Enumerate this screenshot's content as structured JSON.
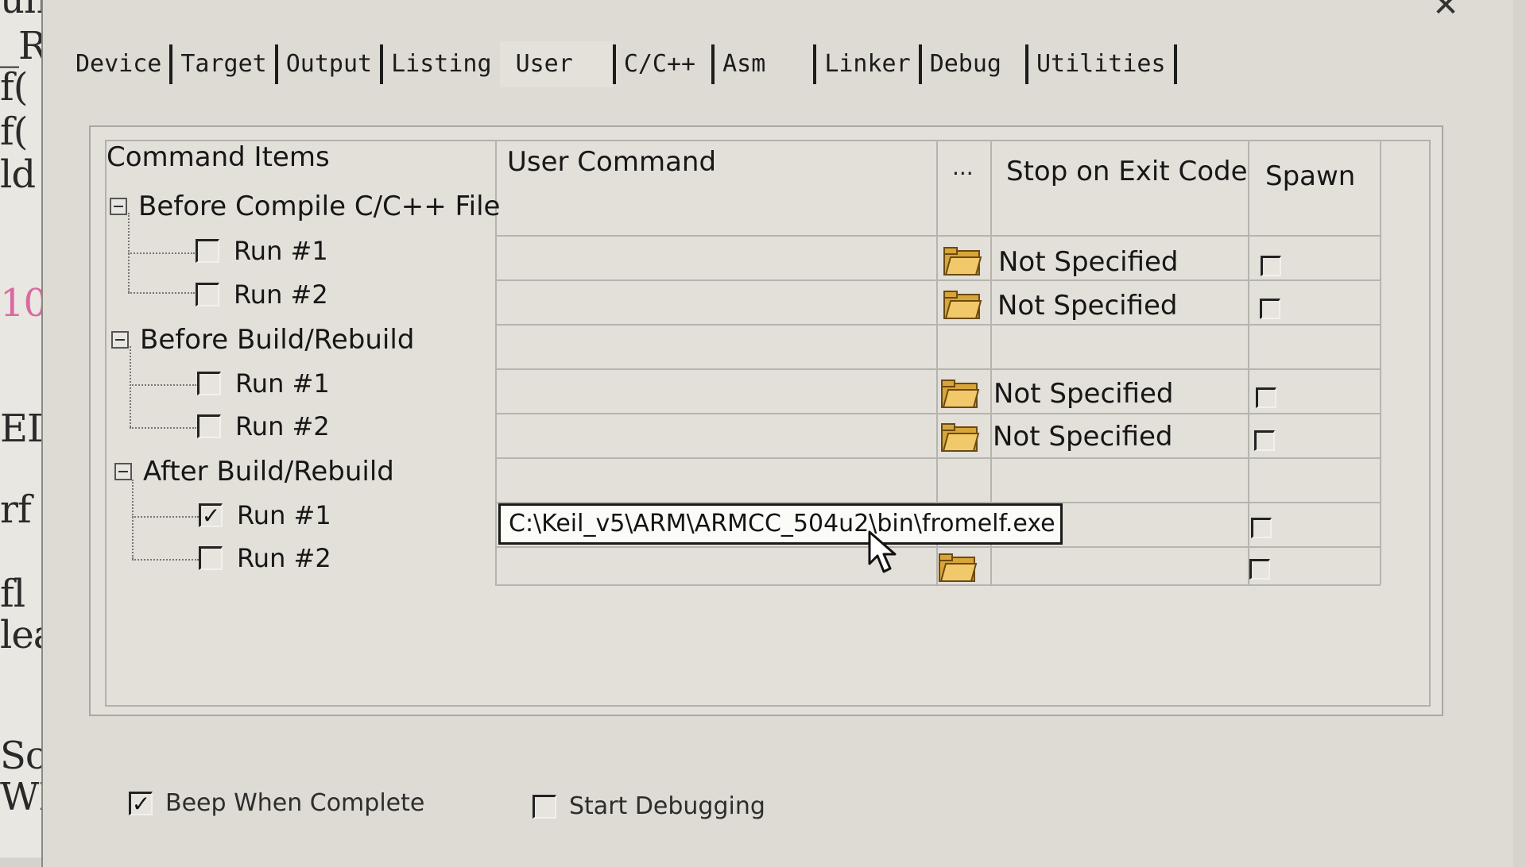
{
  "editor_lines": [
    {
      "text": "un",
      "red": false
    },
    {
      "text": "_R",
      "red": false
    },
    {
      "text": "f(",
      "red": false
    },
    {
      "text": "f(",
      "red": false
    },
    {
      "text": "ld",
      "red": false
    },
    {
      "text": "10",
      "red": true
    },
    {
      "text": "ED",
      "red": false
    },
    {
      "text": "rf",
      "red": false
    },
    {
      "text": "fl",
      "red": false
    },
    {
      "text": "lea",
      "red": false
    },
    {
      "text": "Sca",
      "red": false
    },
    {
      "text": "WKU",
      "red": false
    }
  ],
  "dialog": {
    "close_glyph": "✕",
    "tabs": [
      {
        "label": "Device",
        "active": false
      },
      {
        "label": "Target",
        "active": false
      },
      {
        "label": "Output",
        "active": false
      },
      {
        "label": "Listing",
        "active": false
      },
      {
        "label": "User",
        "active": true
      },
      {
        "label": "C/C++",
        "active": false
      },
      {
        "label": "Asm",
        "active": false
      },
      {
        "label": "Linker",
        "active": false
      },
      {
        "label": "Debug",
        "active": false
      },
      {
        "label": "Utilities",
        "active": false
      }
    ]
  },
  "grid": {
    "headers": {
      "command_items": "Command Items",
      "user_command": "User Command",
      "browse": "...",
      "stop_on_exit": "Stop on Exit Code",
      "spawn": "Spawn"
    },
    "groups": [
      {
        "label": "Before Compile C/C++ File"
      },
      {
        "label": "Before Build/Rebuild"
      },
      {
        "label": "After Build/Rebuild"
      }
    ],
    "runs": [
      {
        "label": "Run #1",
        "checked": false,
        "command": "",
        "stop_code": "Not Specified",
        "spawn": false
      },
      {
        "label": "Run #2",
        "checked": false,
        "command": "",
        "stop_code": "Not Specified",
        "spawn": false
      },
      {
        "label": "Run #1",
        "checked": false,
        "command": "",
        "stop_code": "Not Specified",
        "spawn": false
      },
      {
        "label": "Run #2",
        "checked": false,
        "command": "",
        "stop_code": "Not Specified",
        "spawn": false
      },
      {
        "label": "Run #1",
        "checked": true,
        "command": "C:\\Keil_v5\\ARM\\ARMCC_504u2\\bin\\fromelf.exe",
        "stop_code": "",
        "spawn": false
      },
      {
        "label": "Run #2",
        "checked": false,
        "command": "",
        "stop_code": "",
        "spawn": false
      }
    ]
  },
  "options": {
    "beep_label": "Beep When Complete",
    "beep_checked": true,
    "debug_label": "Start Debugging",
    "debug_checked": false
  },
  "check_glyph": "✓"
}
